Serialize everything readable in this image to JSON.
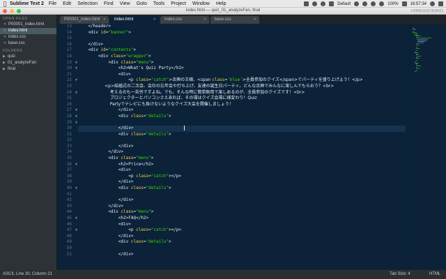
{
  "menubar": {
    "app": "Sublime Text 2",
    "items": [
      "File",
      "Edit",
      "Selection",
      "Find",
      "View",
      "Goto",
      "Tools",
      "Project",
      "Window",
      "Help"
    ],
    "tray_default": "Default",
    "battery": "100%",
    "clock": "16:57:34"
  },
  "window": {
    "title": "index.html — quiz_01_analyzeFan, final",
    "unregistered": "UNREGISTERED"
  },
  "sidebar": {
    "open_files_label": "OPEN FILES",
    "open_files": [
      "P00001_index.html",
      "index.html",
      "index.css",
      "base.css"
    ],
    "folders_label": "FOLDERS",
    "folders": [
      "quiz",
      "01_analyzeFan",
      "final"
    ]
  },
  "tabs": [
    "P00001_index.html",
    "index.html",
    "index.css",
    "base.css"
  ],
  "editor": {
    "line_numbers": [
      "13",
      "14",
      "15",
      "16",
      "17",
      "18",
      "19",
      "20",
      "21",
      "22",
      "23",
      "24",
      "25",
      "26",
      "27",
      "28",
      "29",
      "30",
      "31",
      "32",
      "33",
      "34",
      "35",
      "36",
      "37",
      "38",
      "39",
      "40",
      "41",
      "42",
      "43",
      "44",
      "45",
      "46",
      "47",
      "48",
      "49",
      "50",
      "51"
    ],
    "lines": [
      "    </header>",
      "    <div id=\"banner\">",
      "",
      "    </div>",
      "    <div id=\"contents\">",
      "        <div class=\"wrapper\">",
      "            <div class=\"menu\">",
      "                <h2>What's Quiz Party</h2>",
      "                <div>",
      "                    <p class=\"catch\">余興の王様、<span class='blue'>全員参加のクイズ</span>でパーティを盛り上げよう！</p>",
      "                    <p>結婚式の二次会、会社の忘年会や打ち上げ、友達の誕生日パーティ。どんな余興でみんなに楽しんでもらおう？<br>",
      "                        考えるのも一苦労ですよね。でも、そんな時に簡単無用で楽しめるのが、全員参加のクイズです！<br>",
      "                        プロジェクターとパソコンさえあれば、その場はクイズ会場に様変わり！Quiz",
      "                        Partyでテレビにも負けないようなクイズ大会を開催しましょう！",
      "                </div>",
      "                <div class=\"details\">",
      "",
      "                </div>",
      "                <div class=\"details\">",
      "",
      "                </div>",
      "            </div>",
      "            <div class=\"menu\">",
      "                <h2>Price</h2>",
      "                <div>",
      "                    <p class=\"catch\"></p>",
      "                </div>",
      "                <div class=\"details\">",
      "",
      "                </div>",
      "            </div>",
      "            <div class=\"menu\">",
      "                <h2>FAQ</h2>",
      "                <div>",
      "                    <p class=\"catch\"></p>",
      "                </div>",
      "                <div class=\"details\">",
      "",
      "                </div>",
      "            </div>"
    ],
    "fold_lines": [
      "19",
      "20",
      "22",
      "24",
      "27",
      "28",
      "29",
      "36",
      "40",
      "45",
      "47"
    ]
  },
  "statusbar": {
    "position": "ASCII, Line 30, Column 21",
    "tab_size": "Tab Size: 4",
    "syntax": "HTML"
  }
}
